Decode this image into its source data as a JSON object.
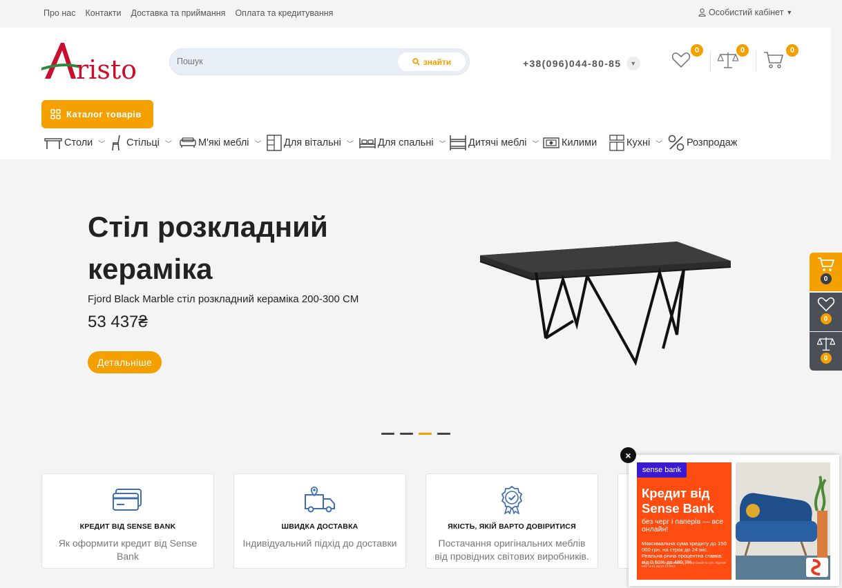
{
  "topbar": {
    "links": [
      "Про нас",
      "Контакти",
      "Доставка та приймання",
      "Оплата та кредитування"
    ],
    "account": "Особистий кабінет"
  },
  "header": {
    "logo_text": "Aristo",
    "search_placeholder": "Пошук",
    "search_button": "знайти",
    "phone": "+38(096)044-80-85",
    "wishlist_count": "0",
    "compare_count": "0",
    "cart_count": "0",
    "catalog_button": "Каталог товарів"
  },
  "nav": [
    {
      "label": "Столи",
      "icon": "table-icon",
      "has_dropdown": true
    },
    {
      "label": "Стільці",
      "icon": "chair-icon",
      "has_dropdown": true
    },
    {
      "label": "М'які меблі",
      "icon": "sofa-icon",
      "has_dropdown": true
    },
    {
      "label": "Для вітальні",
      "icon": "cabinet-icon",
      "has_dropdown": true
    },
    {
      "label": "Для спальні",
      "icon": "bed-icon",
      "has_dropdown": true
    },
    {
      "label": "Дитячі меблі",
      "icon": "bunk-bed-icon",
      "has_dropdown": true
    },
    {
      "label": "Килими",
      "icon": "carpet-icon",
      "has_dropdown": false
    },
    {
      "label": "Кухні",
      "icon": "kitchen-icon",
      "has_dropdown": true
    },
    {
      "label": "Розпродаж",
      "icon": "percent-icon",
      "has_dropdown": false
    }
  ],
  "hero": {
    "title": "Стіл розкладний кераміка",
    "subtitle": "Fjord Black Marble стіл розкладний кераміка 200-300 CM",
    "price": "53 437₴",
    "button": "Детальніше",
    "slides": 4,
    "active_slide": 3
  },
  "features": [
    {
      "icon": "credit-card-icon",
      "title": "КРЕДИТ ВІД SENSE BANK",
      "desc": "Як оформити кредит від Sense Bank"
    },
    {
      "icon": "delivery-truck-icon",
      "title": "ШВИДКА ДОСТАВКА",
      "desc": "Індивідуальний підхід до доставки"
    },
    {
      "icon": "quality-badge-icon",
      "title": "ЯКІСТЬ, ЯКІЙ ВАРТО ДОВІРИТИСЯ",
      "desc": "Постачання оригінальних меблів від провідних світових виробників."
    }
  ],
  "side_panel": {
    "cart_count": "0",
    "wishlist_count": "0",
    "compare_count": "0"
  },
  "promo": {
    "brand": "sense bank",
    "headline": "Кредит від Sense Bank",
    "sub": "без черг і паперів — все онлайн!",
    "details": "Максимальна сума кредиту до 150 000 грн. на строк до 24 міс. Реальна річна процентна ставка: від 0,01% до 480,7%",
    "fine": "АТ «Сенс Банк». У Державному реєстрі банків № 158. Ліцензія НБУ № 61 від 01.12.2022"
  },
  "colors": {
    "accent": "#f4a000",
    "side_dark": "#4a4f58",
    "promo_orange": "#ff4d12"
  }
}
